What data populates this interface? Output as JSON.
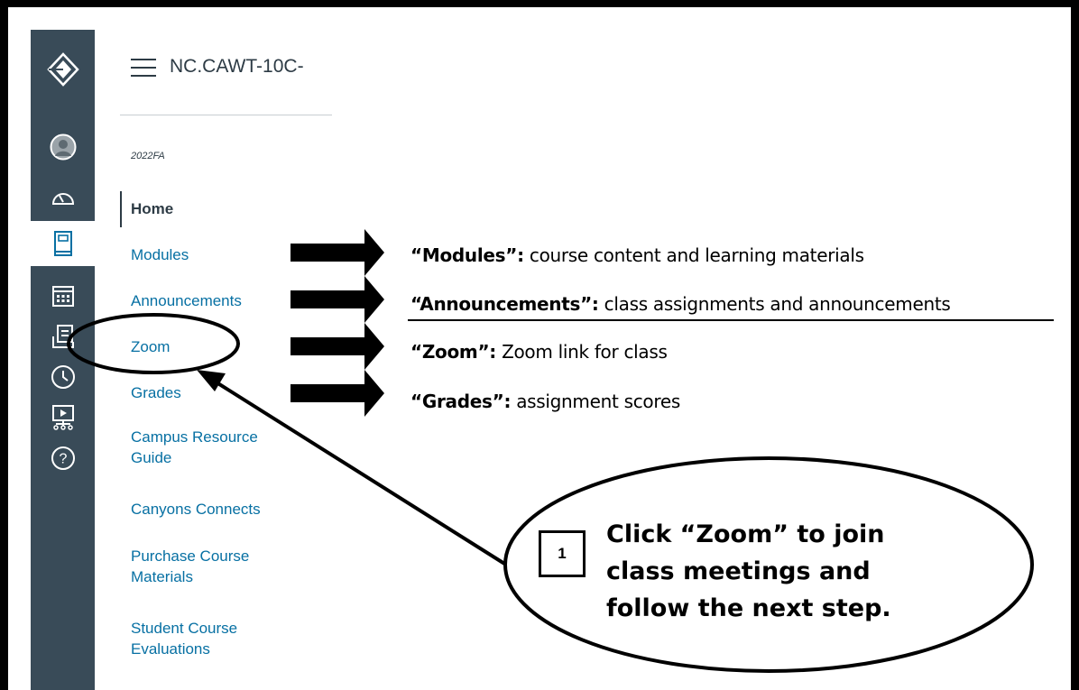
{
  "course": {
    "title": "NC.CAWT-10C-",
    "term": "2022FA"
  },
  "global_nav": {
    "items": [
      {
        "name": "logo",
        "icon": "canvas-logo-icon"
      },
      {
        "name": "account",
        "icon": "user-avatar-icon"
      },
      {
        "name": "dashboard",
        "icon": "dashboard-icon"
      },
      {
        "name": "courses",
        "icon": "book-icon"
      },
      {
        "name": "calendar",
        "icon": "calendar-icon"
      },
      {
        "name": "inbox",
        "icon": "inbox-icon"
      },
      {
        "name": "history",
        "icon": "clock-icon"
      },
      {
        "name": "studio",
        "icon": "studio-icon"
      },
      {
        "name": "help",
        "icon": "help-icon"
      }
    ],
    "colors": {
      "background": "#394B58",
      "active_background": "#ffffff",
      "active_icon": "#2D3B45",
      "icon": "#ffffff"
    }
  },
  "course_nav": {
    "items": [
      {
        "label": "Home",
        "active": true
      },
      {
        "label": "Modules"
      },
      {
        "label": "Announcements"
      },
      {
        "label": "Zoom"
      },
      {
        "label": "Grades"
      },
      {
        "label": "Campus Resource",
        "label2": "Guide"
      },
      {
        "label": "Canyons Connects"
      },
      {
        "label": "Purchase Course",
        "label2": "Materials"
      },
      {
        "label": "Student Course",
        "label2": "Evaluations"
      }
    ],
    "colors": {
      "link": "#0770A3",
      "active": "#2D3B45"
    }
  },
  "annotations": {
    "descriptions": [
      {
        "term": "“Modules”:",
        "text": " course content and learning materials"
      },
      {
        "term": "“Announcements”:",
        "text": " class assignments and announcements"
      },
      {
        "term": "“Zoom”:",
        "text": " Zoom link for class"
      },
      {
        "term": "“Grades”:",
        "text": " assignment scores"
      }
    ],
    "callout": {
      "step": "1",
      "lines": [
        "Click “Zoom” to join",
        "class meetings and",
        "follow the next step."
      ]
    }
  }
}
